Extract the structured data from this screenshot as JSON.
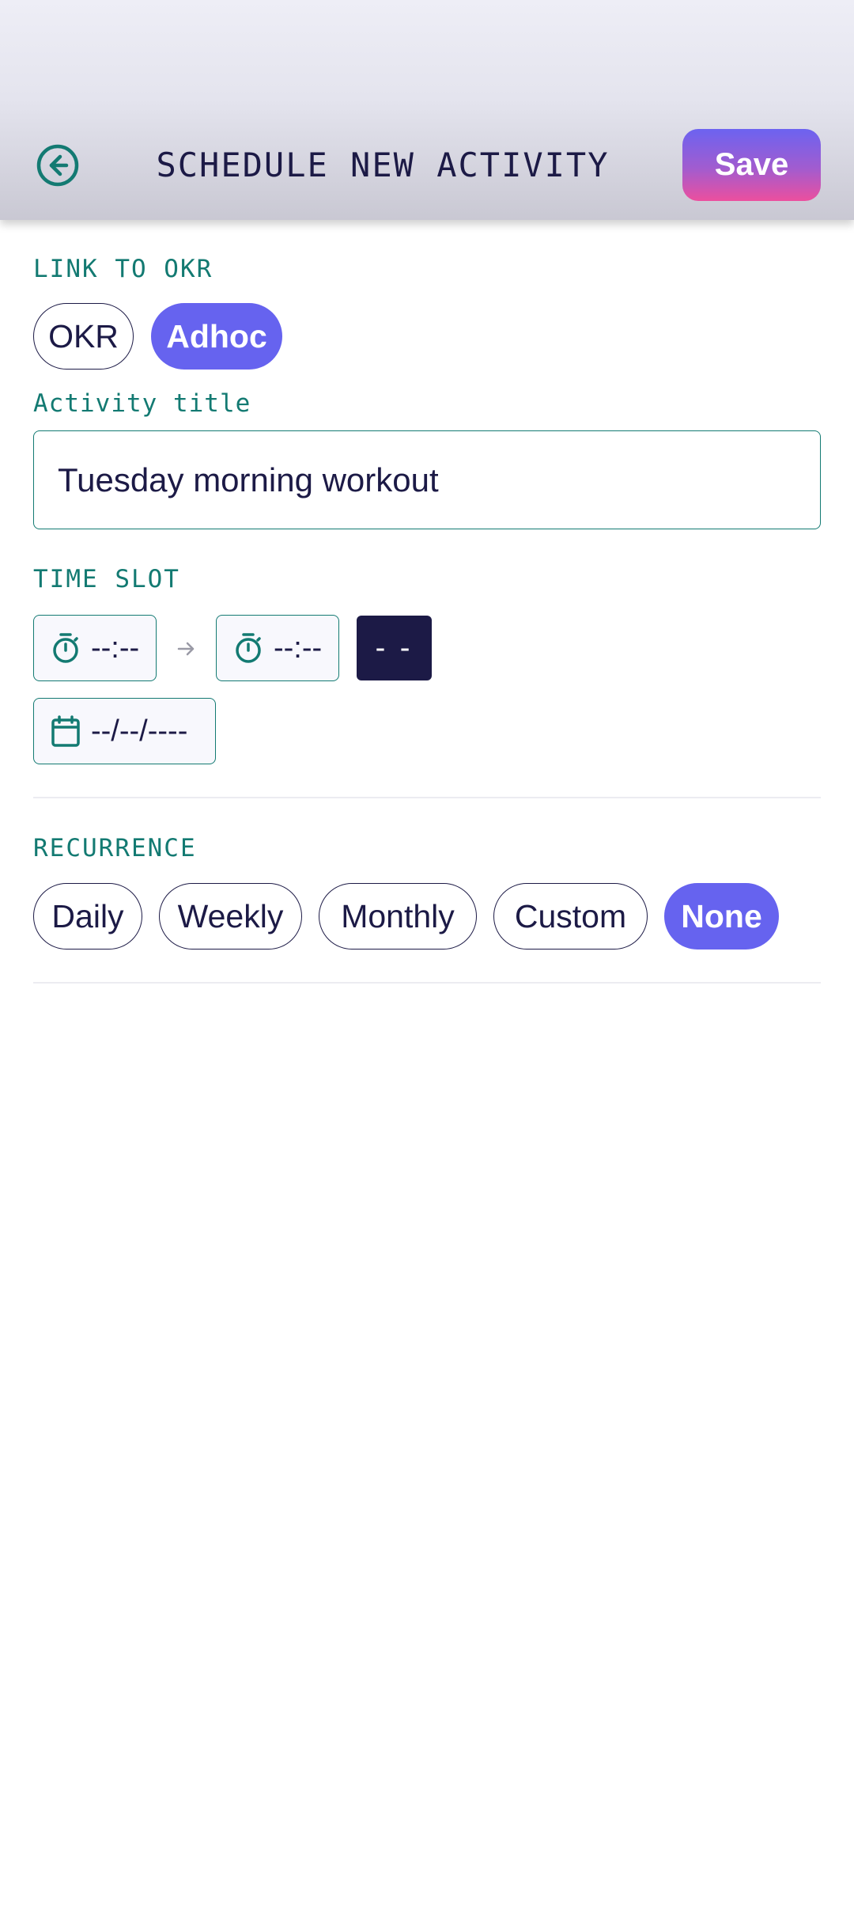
{
  "header": {
    "title": "SCHEDULE NEW ACTIVITY",
    "save_label": "Save",
    "back_icon": "arrow-left-circle-icon"
  },
  "okr_section": {
    "label": "LINK TO OKR",
    "options": [
      "OKR",
      "Adhoc"
    ],
    "selected": "Adhoc"
  },
  "activity_title": {
    "label": "Activity title",
    "value": "Tuesday morning workout"
  },
  "time_slot": {
    "label": "TIME SLOT",
    "start_time": "--:--",
    "end_time": "--:--",
    "ampm": "- -",
    "date": "--/--/----"
  },
  "recurrence": {
    "label": "RECURRENCE",
    "options": [
      "Daily",
      "Weekly",
      "Monthly",
      "Custom",
      "None"
    ],
    "selected": "None"
  },
  "colors": {
    "accent": "#6663ef",
    "teal": "#137a72",
    "navy": "#1c1a46",
    "save_gradient_top": "#6c63f0",
    "save_gradient_bottom": "#ec4f9e"
  }
}
